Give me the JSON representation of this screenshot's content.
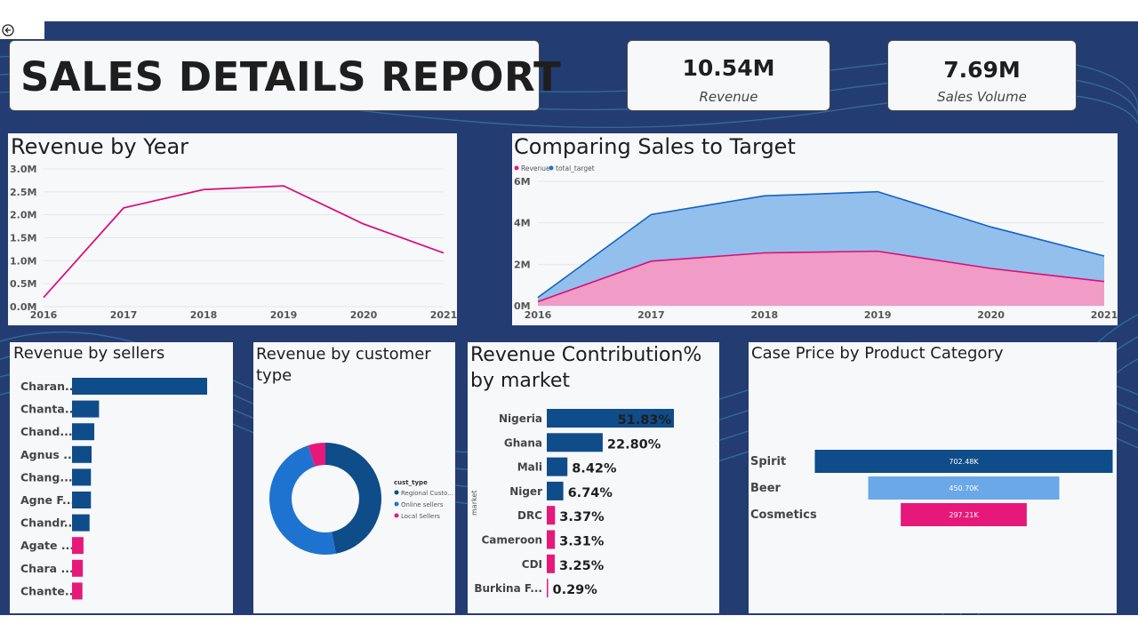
{
  "header": {
    "title": "SALES DETAILS REPORT",
    "kpis": [
      {
        "value": "10.54M",
        "label": "Revenue"
      },
      {
        "value": "7.69M",
        "label": "Sales Volume"
      }
    ]
  },
  "icons": {
    "back": "back-arrow-icon"
  },
  "colors": {
    "background": "#233d73",
    "card": "#f7f8fa",
    "dark_blue": "#0f4c8a",
    "pink": "#e6197a",
    "mid_blue": "#1f73d0",
    "light_blue": "#6aa8e8"
  },
  "chart_data": [
    {
      "id": "revenue_by_year",
      "type": "line",
      "title": "Revenue by Year",
      "x": [
        "2016",
        "2017",
        "2018",
        "2019",
        "2020",
        "2021"
      ],
      "series": [
        {
          "values": [
            0.2,
            2.15,
            2.55,
            2.63,
            1.8,
            1.17
          ]
        }
      ],
      "y_ticks": [
        "0.0M",
        "0.5M",
        "1.0M",
        "1.5M",
        "2.0M",
        "2.5M",
        "3.0M"
      ],
      "ylim": [
        0,
        3.0
      ]
    },
    {
      "id": "sales_vs_target",
      "type": "area",
      "title": "Comparing Sales to Target",
      "x": [
        "2016",
        "2017",
        "2018",
        "2019",
        "2020",
        "2021"
      ],
      "series": [
        {
          "name": "Revenue",
          "values": [
            0.2,
            2.15,
            2.55,
            2.63,
            1.8,
            1.17
          ]
        },
        {
          "name": "total_target",
          "values": [
            0.4,
            4.4,
            5.3,
            5.5,
            3.8,
            2.4
          ]
        }
      ],
      "y_ticks": [
        "0M",
        "2M",
        "4M",
        "6M"
      ],
      "ylim": [
        0,
        6
      ],
      "legend_position": "top-left"
    },
    {
      "id": "revenue_by_sellers",
      "type": "bar",
      "title": "Revenue by sellers",
      "categories": [
        "Charan...",
        "Chanta...",
        "Chand...",
        "Agnus ...",
        "Chang...",
        "Agne F...",
        "Chandr...",
        "Agate ...",
        "Chara ...",
        "Chante..."
      ],
      "values": [
        100,
        20,
        16.5,
        14.5,
        14,
        14,
        13,
        8.5,
        8,
        7.7
      ],
      "bar_colors": [
        "dark_blue",
        "dark_blue",
        "dark_blue",
        "dark_blue",
        "dark_blue",
        "dark_blue",
        "dark_blue",
        "pink",
        "pink",
        "pink"
      ]
    },
    {
      "id": "revenue_by_customer_type",
      "type": "pie",
      "title": [
        "Revenue by customer",
        "type"
      ],
      "legend_title": "cust_type",
      "labels": [
        "Regional Custo...",
        "Online sellers",
        "Local Sellers"
      ],
      "values": [
        47,
        48,
        5
      ],
      "slice_colors": [
        "dark_blue",
        "mid_blue",
        "pink"
      ],
      "legend_position": "right"
    },
    {
      "id": "revenue_contribution_by_market",
      "type": "bar",
      "title": [
        "Revenue Contribution%",
        "by market"
      ],
      "ylabel": "market",
      "categories": [
        "Nigeria",
        "Ghana",
        "Mali",
        "Niger",
        "DRC",
        "Cameroon",
        "CDI",
        "Burkina F..."
      ],
      "values": [
        51.83,
        22.8,
        8.42,
        6.74,
        3.37,
        3.31,
        3.25,
        0.29
      ],
      "data_labels": [
        "51.83%",
        "22.80%",
        "8.42%",
        "6.74%",
        "3.37%",
        "3.31%",
        "3.25%",
        "0.29%"
      ],
      "bar_colors": [
        "dark_blue",
        "dark_blue",
        "dark_blue",
        "dark_blue",
        "pink",
        "pink",
        "pink",
        "pink"
      ]
    },
    {
      "id": "case_price_by_product_category",
      "type": "bar",
      "title": "Case Price by Product Category",
      "categories": [
        "Spirit",
        "Beer",
        "Cosmetics"
      ],
      "values": [
        702.48,
        450.7,
        297.21
      ],
      "data_labels": [
        "702.48K",
        "450.70K",
        "297.21K"
      ],
      "bar_colors": [
        "dark_blue",
        "light_blue",
        "pink"
      ]
    }
  ]
}
